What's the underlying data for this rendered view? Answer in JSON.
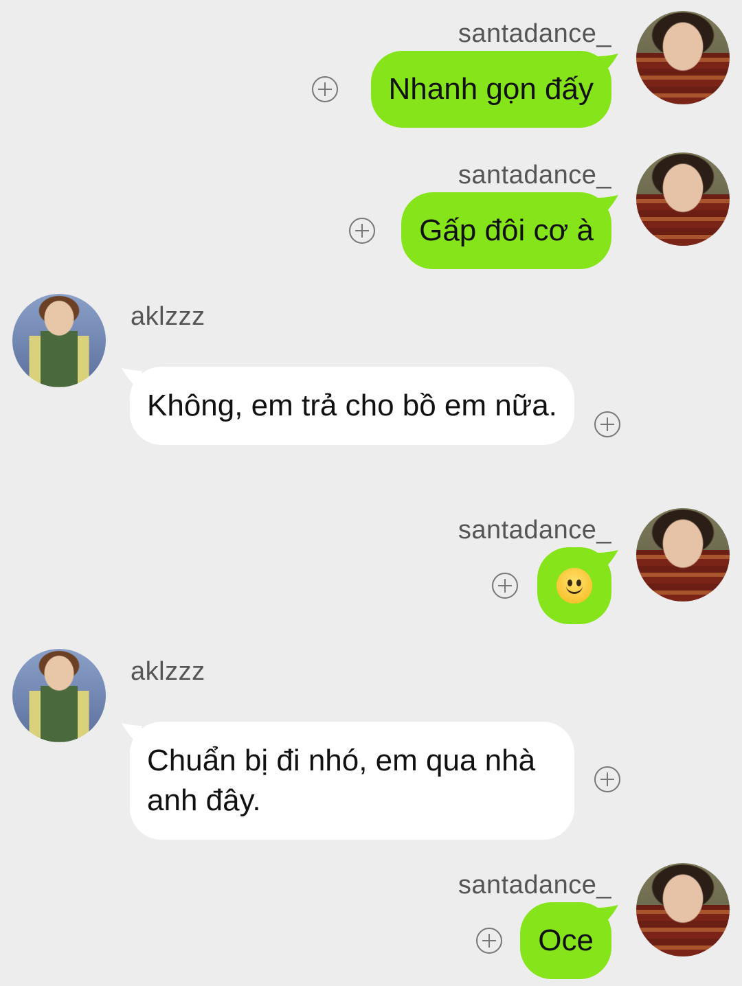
{
  "messages": [
    {
      "sender": "santadance_",
      "direction": "outgoing",
      "text": "Nhanh gọn đấy"
    },
    {
      "sender": "santadance_",
      "direction": "outgoing",
      "text": "Gấp đôi cơ à"
    },
    {
      "sender": "aklzzz",
      "direction": "incoming",
      "text": "Không, em trả cho bồ em nữa."
    },
    {
      "sender": "santadance_",
      "direction": "outgoing",
      "text": "🙂",
      "type": "emoji"
    },
    {
      "sender": "aklzzz",
      "direction": "incoming",
      "text": "Chuẩn bị đi nhó, em qua nhà anh đây."
    },
    {
      "sender": "santadance_",
      "direction": "outgoing",
      "text": "Oce"
    }
  ],
  "colors": {
    "background": "#ededed",
    "outgoing_bubble": "#85e41a",
    "incoming_bubble": "#ffffff",
    "username_text": "#555555"
  },
  "icons": {
    "add": "plus-circle-icon",
    "avatar_outgoing": "avatar-santadance",
    "avatar_incoming": "avatar-aklzzz"
  }
}
